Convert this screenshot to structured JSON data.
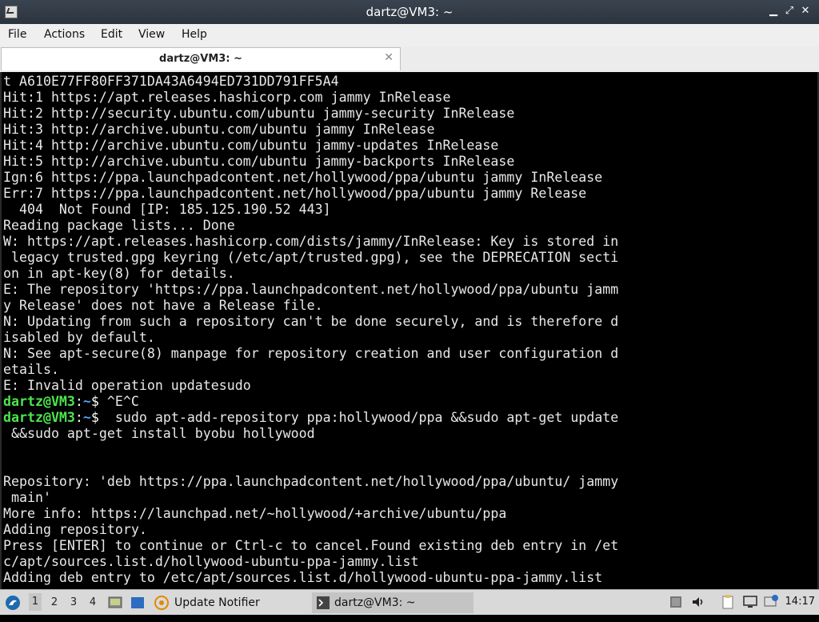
{
  "window": {
    "title": "dartz@VM3: ~",
    "min_glyph": "▁",
    "max_glyph": "⤢",
    "close_glyph": "✕"
  },
  "menu": [
    "File",
    "Actions",
    "Edit",
    "View",
    "Help"
  ],
  "tab": {
    "label": "dartz@VM3: ~",
    "close_glyph": "✕"
  },
  "terminal": {
    "lines": [
      "t A610E77FF80FF371DA43A6494ED731DD791FF5A4",
      "Hit:1 https://apt.releases.hashicorp.com jammy InRelease",
      "Hit:2 http://security.ubuntu.com/ubuntu jammy-security InRelease",
      "Hit:3 http://archive.ubuntu.com/ubuntu jammy InRelease",
      "Hit:4 http://archive.ubuntu.com/ubuntu jammy-updates InRelease",
      "Hit:5 http://archive.ubuntu.com/ubuntu jammy-backports InRelease",
      "Ign:6 https://ppa.launchpadcontent.net/hollywood/ppa/ubuntu jammy InRelease",
      "Err:7 https://ppa.launchpadcontent.net/hollywood/ppa/ubuntu jammy Release",
      "  404  Not Found [IP: 185.125.190.52 443]",
      "Reading package lists... Done",
      "W: https://apt.releases.hashicorp.com/dists/jammy/InRelease: Key is stored in",
      " legacy trusted.gpg keyring (/etc/apt/trusted.gpg), see the DEPRECATION secti",
      "on in apt-key(8) for details.",
      "E: The repository 'https://ppa.launchpadcontent.net/hollywood/ppa/ubuntu jamm",
      "y Release' does not have a Release file.",
      "N: Updating from such a repository can't be done securely, and is therefore d",
      "isabled by default.",
      "N: See apt-secure(8) manpage for repository creation and user configuration d",
      "etails.",
      "E: Invalid operation updatesudo",
      {
        "prompt": true,
        "user": "dartz@VM3",
        "path": "~",
        "cmd": " ^E^C"
      },
      {
        "prompt": true,
        "user": "dartz@VM3",
        "path": "~",
        "cmd": "  sudo apt-add-repository ppa:hollywood/ppa &&sudo apt-get update"
      },
      " &&sudo apt-get install byobu hollywood",
      "",
      "",
      "Repository: 'deb https://ppa.launchpadcontent.net/hollywood/ppa/ubuntu/ jammy",
      " main'",
      "More info: https://launchpad.net/~hollywood/+archive/ubuntu/ppa",
      "Adding repository.",
      "Press [ENTER] to continue or Ctrl-c to cancel.Found existing deb entry in /et",
      "c/apt/sources.list.d/hollywood-ubuntu-ppa-jammy.list",
      "Adding deb entry to /etc/apt/sources.list.d/hollywood-ubuntu-ppa-jammy.list"
    ]
  },
  "taskbar": {
    "workspaces": [
      "1",
      "2",
      "3",
      "4"
    ],
    "tasks": [
      {
        "label": "Update Notifier",
        "icon": "update-notifier-icon"
      },
      {
        "label": "dartz@VM3: ~",
        "icon": "terminal-icon"
      }
    ],
    "tray_icons": [
      "network-icon",
      "volume-icon",
      "clipboard-icon",
      "monitor-icon",
      "notification-icon"
    ],
    "clock": "14:17"
  }
}
